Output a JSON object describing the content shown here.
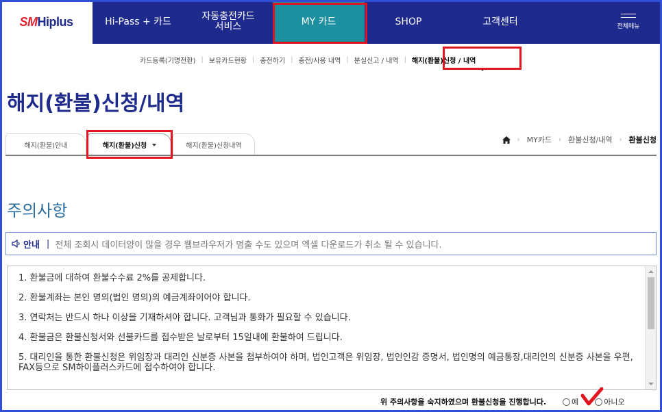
{
  "brand": {
    "logo_red": "SM",
    "logo_blue": "Hiplus",
    "primary_color": "#1e2a8c",
    "active_nav_color": "#1c8fa1",
    "highlight_color": "#e0151f"
  },
  "topnav": {
    "items": [
      {
        "label": "Hi-Pass + 카드"
      },
      {
        "label": "자동충전카드\n서비스"
      },
      {
        "label": "MY 카드",
        "active": true
      },
      {
        "label": "SHOP"
      },
      {
        "label": "고객센터"
      }
    ],
    "allmenu_label": "전체메뉴",
    "allmenu_icon": "hamburger-icon"
  },
  "subnav": {
    "items": [
      {
        "label": "카드등록(기명전환)"
      },
      {
        "label": "보유카드현황"
      },
      {
        "label": "충전하기"
      },
      {
        "label": "충전/사용 내역"
      },
      {
        "label": "분실신고 / 내역"
      },
      {
        "label": "해지(환불)신청 / 내역",
        "current": true
      }
    ]
  },
  "page": {
    "title": "해지(환불)신청/내역"
  },
  "tabs": [
    {
      "label": "해지(환불)안내"
    },
    {
      "label": "해지(환불)신청",
      "active": true
    },
    {
      "label": "해지(환불)신청내역"
    }
  ],
  "breadcrumb": {
    "home_icon": "home-icon",
    "items": [
      "MY카드",
      "환불신청/내역",
      "환불신청"
    ]
  },
  "section": {
    "title": "주의사항"
  },
  "notice": {
    "icon": "speaker-icon",
    "label": "안내",
    "message": "전체 조회시 데이터양이 많을 경우 웹브라우저가 멈출 수도 있으며 엑셀 다운로드가 취소 될 수 있습니다."
  },
  "terms": [
    "1. 환불금에 대하여 환불수수료 2%를 공제합니다.",
    "2. 환불계좌는 본인 명의(법인 명의)의 예금계좌이어야 합니다.",
    "3. 연락처는 반드시 하나 이상을 기재하셔야 합니다. 고객님과 통화가 필요할 수 있습니다.",
    "4. 환불금은 환불신청서와 선불카드를 접수받은 날로부터 15일내에 환불하여 드립니다.",
    "5. 대리인을 통한 환불신청은 위임장과 대리인 신분증 사본을 첨부하여야 하며, 법인고객은 위임장, 법인인감 증명서, 법인명의 예금통장,대리인의 신분증 사본을 우편, FAX등으로 SM하이플러스카드에 접수하여야 합니다."
  ],
  "agreement": {
    "text": "위 주의사항을 숙지하였으며 환불신청을 진행합니다.",
    "yes_label": "예",
    "no_label": "아니오"
  }
}
